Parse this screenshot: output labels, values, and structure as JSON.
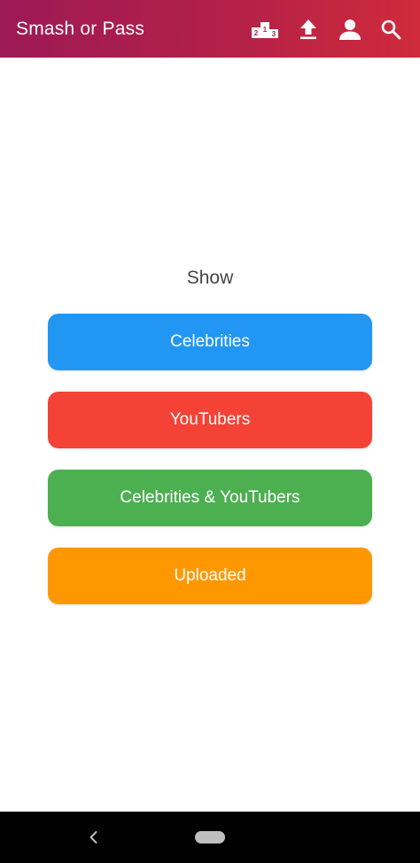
{
  "app_bar": {
    "title_part1": "Smash",
    "title_part2": "or",
    "title_part3": "Pass",
    "gradient_start": "#9c1a56",
    "gradient_end": "#cf2b3b",
    "actions": [
      {
        "icon": "leaderboard-podium-icon",
        "podium_digits": [
          "2",
          "1",
          "3"
        ]
      },
      {
        "icon": "upload-icon"
      },
      {
        "icon": "account-icon"
      },
      {
        "icon": "search-icon"
      }
    ]
  },
  "main": {
    "show_label": "Show",
    "buttons": [
      {
        "label": "Celebrities",
        "color": "#2196F3"
      },
      {
        "label": "YouTubers",
        "color": "#F44336"
      },
      {
        "label": "Celebrities & YouTubers",
        "color": "#4CAF50"
      },
      {
        "label": "Uploaded",
        "color": "#FF9800"
      }
    ]
  },
  "system_nav": {
    "back_icon": "chevron-left-icon",
    "home_icon": "home-pill-icon"
  }
}
